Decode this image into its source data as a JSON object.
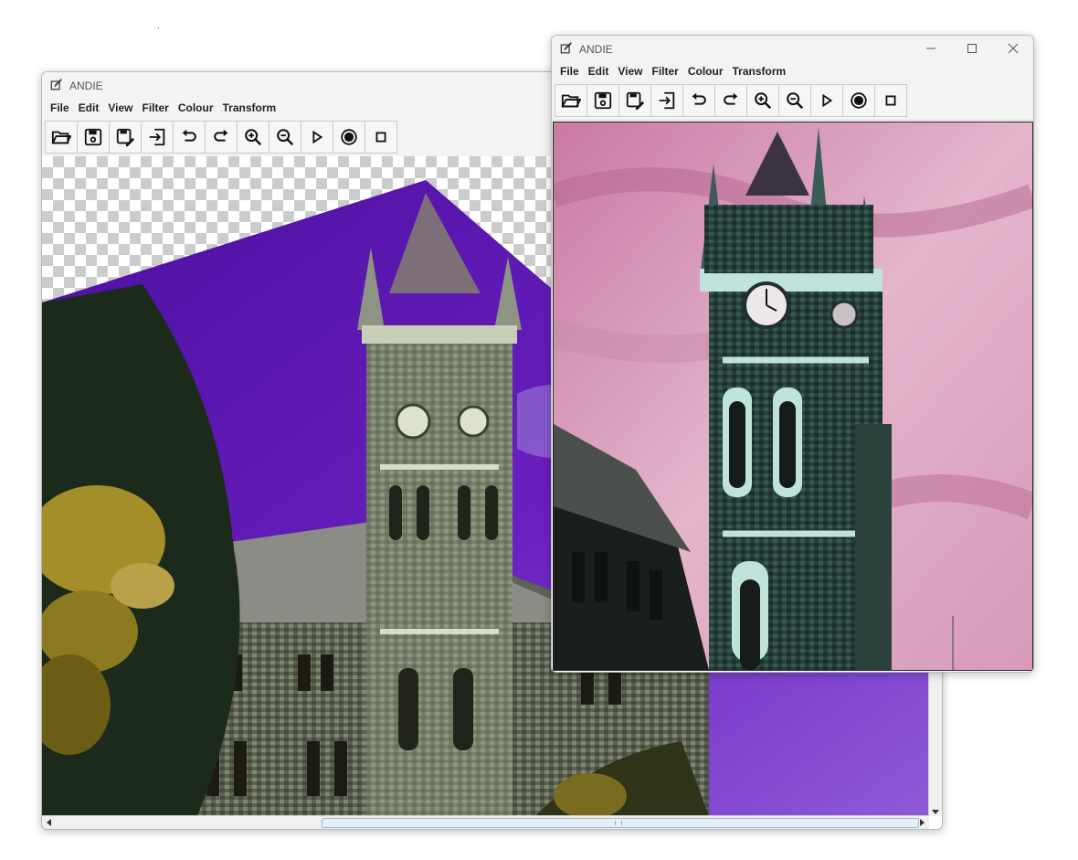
{
  "app": {
    "title": "ANDIE"
  },
  "menu": [
    "File",
    "Edit",
    "View",
    "Filter",
    "Colour",
    "Transform"
  ],
  "toolbar": [
    {
      "icon": "open-folder-icon"
    },
    {
      "icon": "save-icon"
    },
    {
      "icon": "save-as-icon"
    },
    {
      "icon": "export-icon"
    },
    {
      "icon": "undo-icon"
    },
    {
      "icon": "redo-icon"
    },
    {
      "icon": "zoom-in-icon"
    },
    {
      "icon": "zoom-out-icon"
    },
    {
      "icon": "play-icon"
    },
    {
      "icon": "record-icon"
    },
    {
      "icon": "stop-icon"
    }
  ],
  "back_window": {
    "image": "rotated colour-inverted clock tower photo with purple sky, transparent checkerboard background",
    "colors": {
      "sky": "#6a1fbf",
      "foliage": "#1c2a1c",
      "stone": "#8f9682"
    }
  },
  "front_window": {
    "window_controls": [
      "minimize-icon",
      "maximize-icon",
      "close-icon"
    ],
    "image": "clock tower photo with pink sky and teal stone",
    "colors": {
      "sky": "#d89ab8",
      "stone": "#2f5a52",
      "trim": "#bfe3da"
    }
  }
}
